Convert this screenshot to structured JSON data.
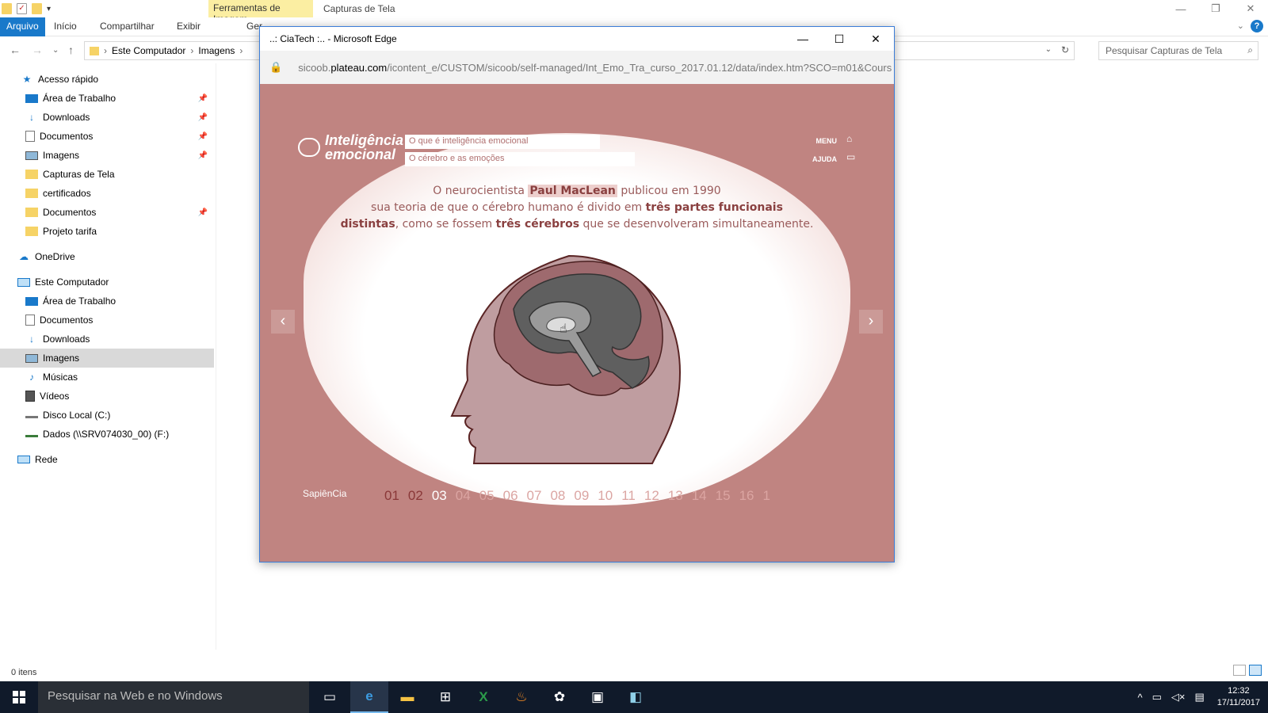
{
  "explorer": {
    "context_tab": "Ferramentas de Imagem",
    "title": "Capturas de Tela",
    "ribbon_tabs": [
      "Arquivo",
      "Início",
      "Compartilhar",
      "Exibir",
      "Ger"
    ],
    "breadcrumb": [
      "Este Computador",
      "Imagens"
    ],
    "search_placeholder": "Pesquisar Capturas de Tela",
    "sidebar": {
      "quick_access": "Acesso rápido",
      "quick_items": [
        {
          "label": "Área de Trabalho",
          "icon": "desktop-icon",
          "pinned": true
        },
        {
          "label": "Downloads",
          "icon": "download-icon",
          "pinned": true
        },
        {
          "label": "Documentos",
          "icon": "document-icon",
          "pinned": true
        },
        {
          "label": "Imagens",
          "icon": "pictures-icon",
          "pinned": true
        },
        {
          "label": "Capturas de Tela",
          "icon": "folder-icon",
          "pinned": false
        },
        {
          "label": "certificados",
          "icon": "folder-icon",
          "pinned": false
        },
        {
          "label": "Documentos",
          "icon": "folder-icon",
          "pinned": true
        },
        {
          "label": "Projeto tarifa",
          "icon": "folder-icon",
          "pinned": false
        }
      ],
      "onedrive": "OneDrive",
      "this_pc": "Este Computador",
      "pc_items": [
        {
          "label": "Área de Trabalho",
          "icon": "desktop-icon"
        },
        {
          "label": "Documentos",
          "icon": "document-icon"
        },
        {
          "label": "Downloads",
          "icon": "download-icon"
        },
        {
          "label": "Imagens",
          "icon": "pictures-icon",
          "selected": true
        },
        {
          "label": "Músicas",
          "icon": "music-icon"
        },
        {
          "label": "Vídeos",
          "icon": "video-icon"
        },
        {
          "label": "Disco Local (C:)",
          "icon": "drive-icon"
        },
        {
          "label": "Dados (\\\\SRV074030_00) (F:)",
          "icon": "network-drive-icon"
        }
      ],
      "network": "Rede"
    },
    "status": "0 itens"
  },
  "edge": {
    "title": "..: CiaTech :.. - Microsoft Edge",
    "url_prefix": "sicoob.",
    "url_domain": "plateau.com",
    "url_path": "/icontent_e/CUSTOM/sicoob/self-managed/Int_Emo_Tra_curso_2017.01.12/data/index.htm?SCO=m01&Cours"
  },
  "course": {
    "logo_line1": "Inteligência",
    "logo_line2": "emocional",
    "topic1": "O que é inteligência emocional",
    "topic2": "O cérebro e as emoções",
    "menu": "MENU",
    "help": "AJUDA",
    "text": {
      "p1": "O neurocientista ",
      "name": "Paul MacLean",
      "p2": " publicou em 1990",
      "p3": "sua teoria de que o cérebro humano é divido em ",
      "b1": "três partes funcionais",
      "b2": "distintas",
      "p4": ", como se fossem ",
      "b3": "três cérebros",
      "p5": " que se desenvolveram simultaneamente."
    },
    "brand": "SapiênCia",
    "pages": [
      "01",
      "02",
      "03",
      "04",
      "05",
      "06",
      "07",
      "08",
      "09",
      "10",
      "11",
      "12",
      "13",
      "14",
      "15",
      "16",
      "1"
    ],
    "current_page": 3,
    "colors": {
      "background": "#c08481",
      "accent": "#8a4040"
    }
  },
  "taskbar": {
    "search": "Pesquisar na Web e no Windows",
    "time": "12:32",
    "date": "17/11/2017"
  }
}
